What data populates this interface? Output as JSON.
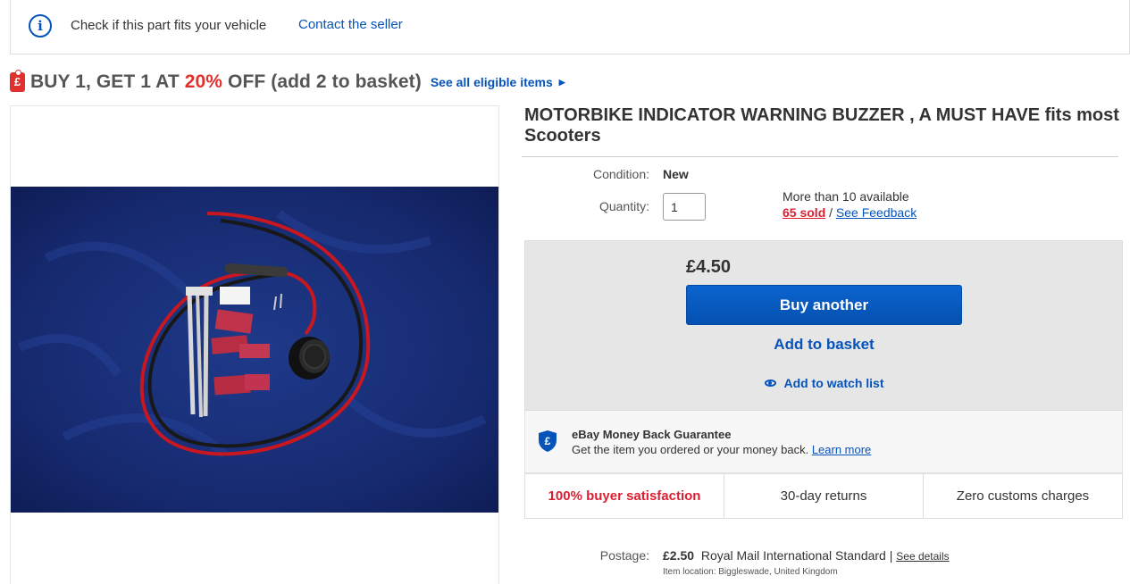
{
  "fit_bar": {
    "text": "Check if this part fits your vehicle",
    "contact": "Contact the seller"
  },
  "promo": {
    "icon_glyph": "£",
    "title_before": "BUY 1, GET 1 AT ",
    "title_percent": "20%",
    "title_after": " OFF (add 2 to basket)",
    "link": "See all eligible items",
    "link_arrow": "▶",
    "accent": "#e0312f"
  },
  "item": {
    "title": "MOTORBIKE INDICATOR WARNING BUZZER , A MUST HAVE fits most Scooters",
    "condition_label": "Condition:",
    "condition": "New",
    "quantity_label": "Quantity:",
    "quantity": "1",
    "availability": "More than 10 available",
    "sold": "65 sold",
    "separator": "/",
    "feedback": "See Feedback"
  },
  "buybox": {
    "price": "£4.50",
    "buy_button": "Buy another",
    "add_to_basket": "Add to basket",
    "watch": "Add to watch list",
    "brand_color": "#0654ba"
  },
  "guarantee": {
    "icon_glyph": "£",
    "title": "eBay Money Back Guarantee",
    "text": "Get the item you ordered or your money back.",
    "learn_more": "Learn more"
  },
  "badges": [
    "100% buyer satisfaction",
    "30-day returns",
    "Zero customs charges"
  ],
  "postage": {
    "label": "Postage:",
    "cost": "£2.50",
    "service": "Royal Mail International Standard",
    "separator": "|",
    "details": "See details",
    "location": "Item location:  Biggleswade, United Kingdom"
  }
}
